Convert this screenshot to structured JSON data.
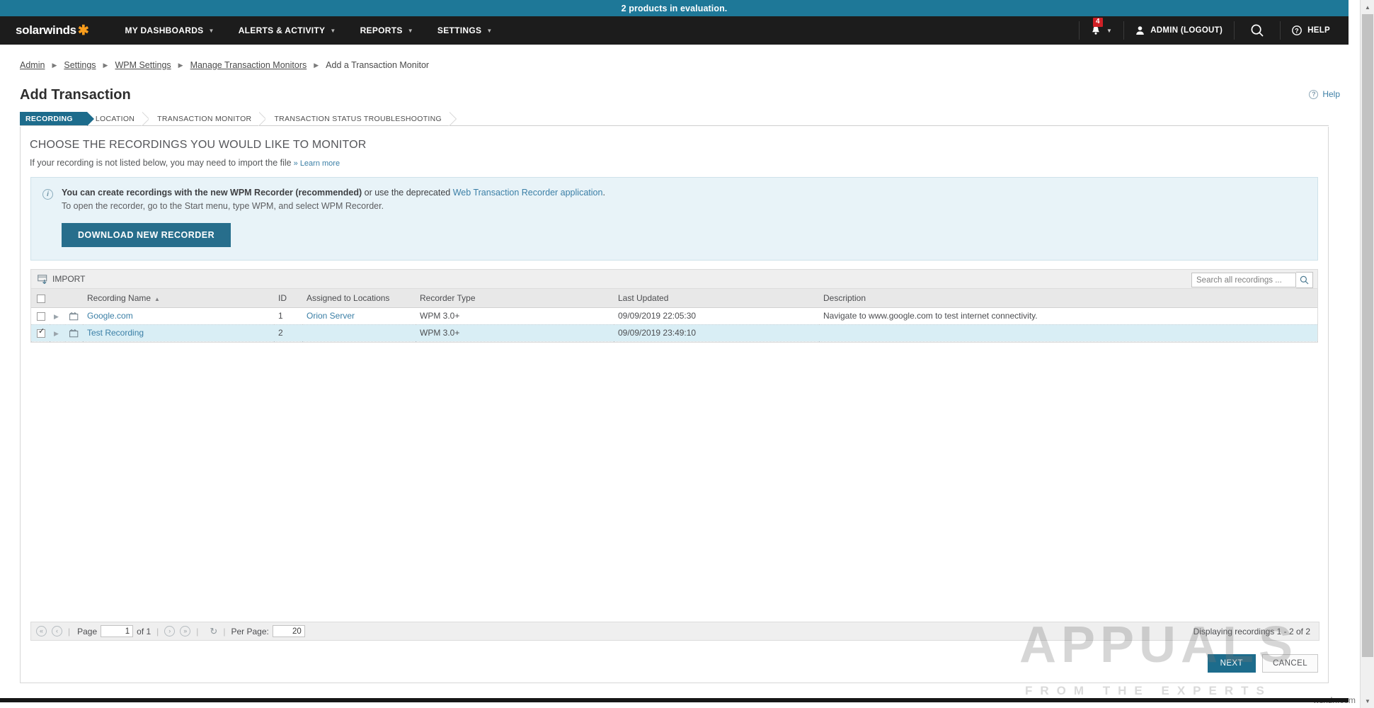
{
  "banner": {
    "text": "2 products in evaluation."
  },
  "nav": {
    "logo": "solarwinds",
    "items": [
      {
        "label": "MY DASHBOARDS"
      },
      {
        "label": "ALERTS & ACTIVITY"
      },
      {
        "label": "REPORTS"
      },
      {
        "label": "SETTINGS"
      }
    ],
    "notifications_count": "4",
    "admin_label": "ADMIN (LOGOUT)",
    "help_label": "HELP"
  },
  "breadcrumb": {
    "items": [
      {
        "label": "Admin",
        "link": true
      },
      {
        "label": "Settings",
        "link": true
      },
      {
        "label": "WPM Settings",
        "link": true
      },
      {
        "label": "Manage Transaction Monitors",
        "link": true
      },
      {
        "label": "Add a Transaction Monitor",
        "link": false
      }
    ]
  },
  "page": {
    "title": "Add Transaction",
    "help_label": "Help"
  },
  "wizard": {
    "steps": [
      {
        "label": "RECORDING",
        "active": true
      },
      {
        "label": "LOCATION",
        "active": false
      },
      {
        "label": "TRANSACTION MONITOR",
        "active": false
      },
      {
        "label": "TRANSACTION STATUS TROUBLESHOOTING",
        "active": false
      }
    ]
  },
  "content": {
    "heading": "CHOOSE THE RECORDINGS YOU WOULD LIKE TO MONITOR",
    "subtext": "If your recording is not listed below, you may need to import the file",
    "learn_more": "» Learn more"
  },
  "infobox": {
    "line1_bold": "You can create recordings with the new WPM Recorder (recommended)",
    "line1_mid": " or use the deprecated ",
    "line1_link": "Web Transaction Recorder application",
    "line1_end": ".",
    "line2": "To open the recorder, go to the Start menu, type WPM, and select WPM Recorder.",
    "download_button": "DOWNLOAD NEW RECORDER"
  },
  "toolbar": {
    "import_label": "IMPORT",
    "search_placeholder": "Search all recordings ...",
    "search_value": ""
  },
  "table": {
    "columns": [
      "Recording Name",
      "ID",
      "Assigned to Locations",
      "Recorder Type",
      "Last Updated",
      "Description"
    ],
    "sort_column": "Recording Name",
    "sort_dir": "asc",
    "rows": [
      {
        "selected": false,
        "name": "Google.com",
        "id": "1",
        "location": "Orion Server",
        "recorder_type": "WPM 3.0+",
        "last_updated": "09/09/2019 22:05:30",
        "description": "Navigate to www.google.com to test internet connectivity."
      },
      {
        "selected": true,
        "name": "Test Recording",
        "id": "2",
        "location": "",
        "recorder_type": "WPM 3.0+",
        "last_updated": "09/09/2019 23:49:10",
        "description": ""
      }
    ]
  },
  "pagination": {
    "page_label": "Page",
    "page_value": "1",
    "of_label": "of 1",
    "per_page_label": "Per Page:",
    "per_page_value": "20",
    "displaying": "Displaying recordings 1 - 2 of 2"
  },
  "actions": {
    "next": "NEXT",
    "cancel": "CANCEL"
  },
  "watermark": {
    "main": "APPUALS",
    "sub": "FROM THE EXPERTS",
    "corner": "wsxdn.com"
  },
  "colors": {
    "accent_teal": "#1d6c8c",
    "banner_teal": "#1e7898",
    "nav_dark": "#1c1c1c",
    "badge_red": "#cf2026",
    "link_blue": "#3b7fa6",
    "row_selected": "#d9eef5",
    "info_bg": "#e8f3f8",
    "logo_orange": "#f99d1c"
  }
}
